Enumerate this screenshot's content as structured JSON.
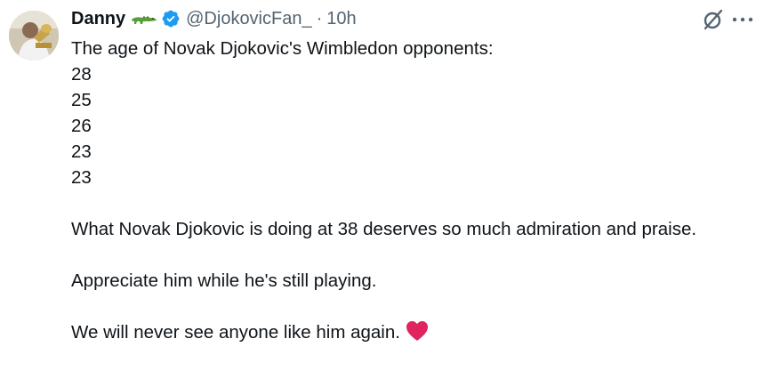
{
  "author": {
    "display_name": "Danny",
    "display_name_emoji": "crocodile-icon",
    "verified": true,
    "verified_color": "#1d9bf0",
    "handle": "@DjokovicFan_",
    "separator": "·",
    "time": "10h"
  },
  "actions": {
    "grok_icon": "grok-icon",
    "more_icon": "more-icon"
  },
  "tweet": {
    "intro": "The age of Novak Djokovic's Wimbledon opponents:",
    "ages": [
      "28",
      "25",
      "26",
      "23",
      "23"
    ],
    "para1": "What Novak Djokovic is doing at 38 deserves so much admiration and praise.",
    "para2": "Appreciate him while he's still playing.",
    "para3": "We will never see anyone like him again.",
    "para3_emoji": "heart-icon"
  },
  "colors": {
    "text": "#0f1419",
    "secondary": "#536471",
    "heart": "#e0245e"
  }
}
